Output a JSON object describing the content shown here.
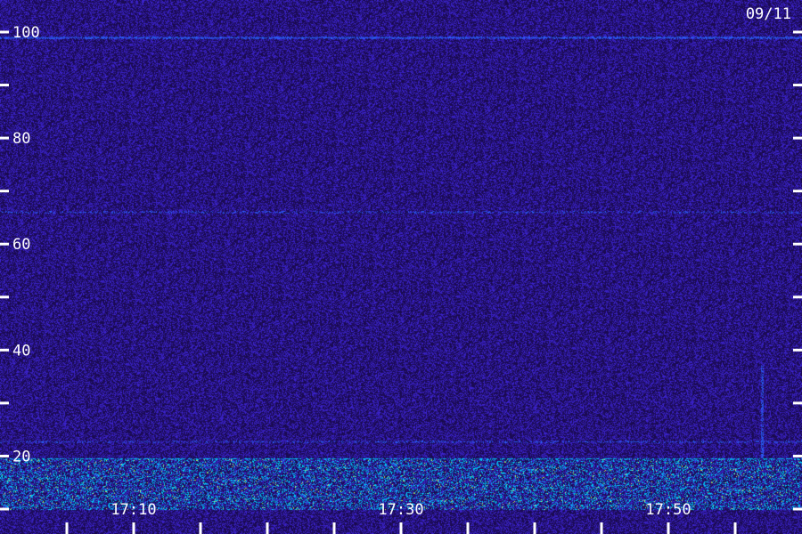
{
  "date_label": "09/11",
  "chart_data": {
    "type": "heatmap",
    "y_tick_labels": [
      "100",
      "80",
      "60",
      "40",
      "20"
    ],
    "y_ticks": [
      100,
      90,
      80,
      70,
      60,
      50,
      40,
      30,
      20,
      10
    ],
    "ylim": [
      10,
      100
    ],
    "x_tick_labels": [
      "17:10",
      "17:30",
      "17:50"
    ],
    "x_ticks": [
      "17:05",
      "17:10",
      "17:15",
      "17:20",
      "17:25",
      "17:30",
      "17:35",
      "17:40",
      "17:45",
      "17:50",
      "17:55"
    ],
    "xlim": [
      "17:00",
      "18:00"
    ],
    "colors": {
      "background": "#1e0c5c",
      "noise": "#3a22c8",
      "line": "#2b5cff",
      "low_band": "#00c8ff",
      "hot": "#c8ff66"
    },
    "features": [
      {
        "kind": "horizontal_line",
        "y": 99,
        "strength": "strong"
      },
      {
        "kind": "horizontal_line",
        "y": 66,
        "strength": "faint"
      },
      {
        "kind": "horizontal_line",
        "y": 22.7,
        "strength": "faint"
      },
      {
        "kind": "band",
        "y_from": 10,
        "y_to": 19.5,
        "strength": "strong"
      },
      {
        "kind": "vertical_streak",
        "time": "17:57",
        "y_from": 18,
        "y_to": 37
      }
    ]
  }
}
